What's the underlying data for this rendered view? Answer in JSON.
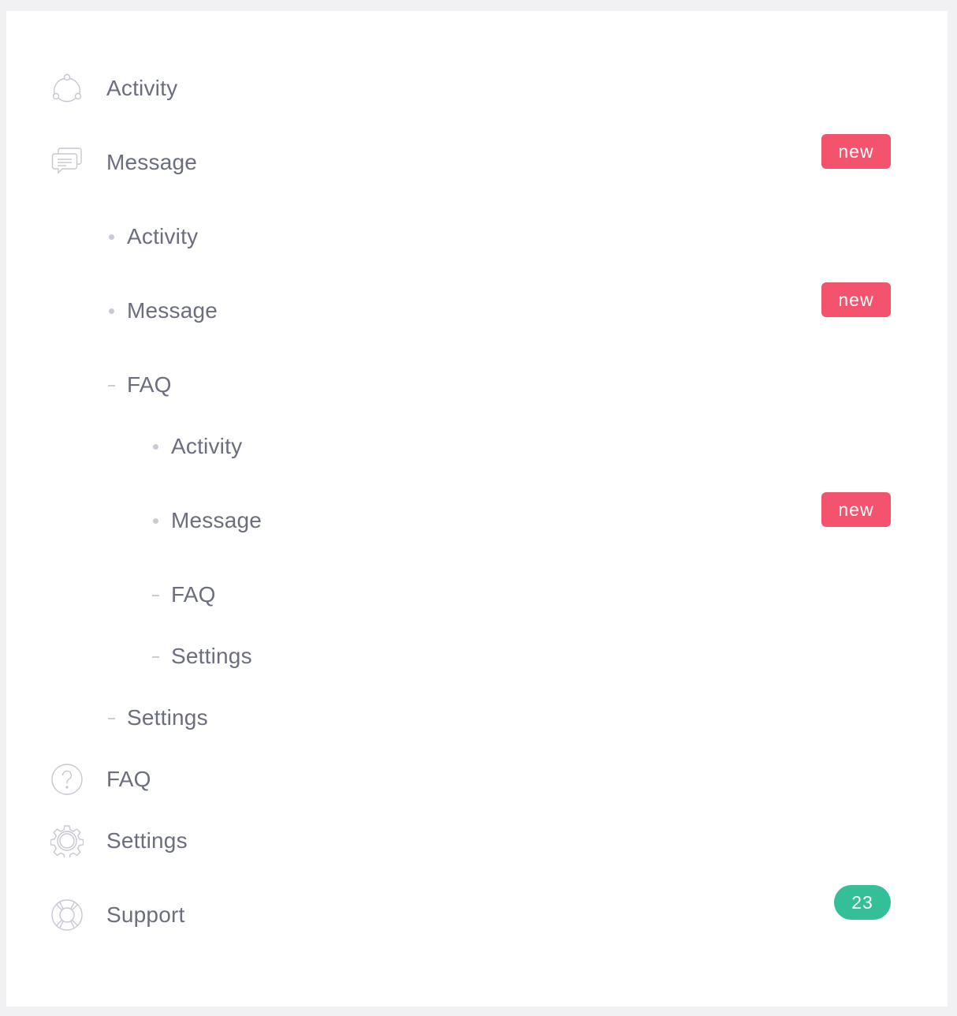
{
  "menu": {
    "activity": {
      "label": "Activity",
      "icon": "activity-icon"
    },
    "message": {
      "label": "Message",
      "icon": "message-icon",
      "badge": "new"
    },
    "message_sub": {
      "activity": {
        "label": "Activity"
      },
      "message": {
        "label": "Message",
        "badge": "new"
      },
      "faq": {
        "label": "FAQ",
        "sub": {
          "activity": {
            "label": "Activity"
          },
          "message": {
            "label": "Message",
            "badge": "new"
          },
          "faq": {
            "label": "FAQ"
          },
          "settings": {
            "label": "Settings"
          }
        }
      },
      "settings": {
        "label": "Settings"
      }
    },
    "faq": {
      "label": "FAQ",
      "icon": "question-icon"
    },
    "settings": {
      "label": "Settings",
      "icon": "gear-icon"
    },
    "support": {
      "label": "Support",
      "icon": "lifebuoy-icon",
      "badge": "23"
    }
  },
  "colors": {
    "badge_new": "#f4536e",
    "badge_count": "#35bf98",
    "text": "#6b6e7e",
    "icon": "#c9cad5"
  }
}
